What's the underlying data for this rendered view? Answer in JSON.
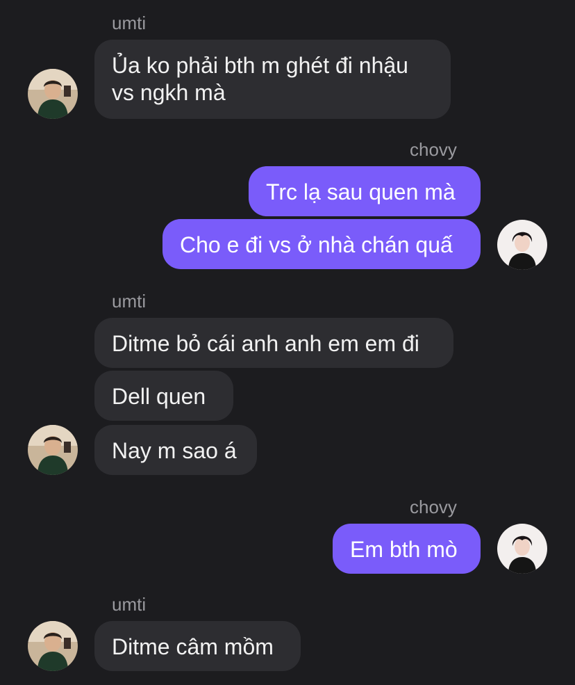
{
  "conversation": {
    "messages": [
      {
        "sender": "umti",
        "text_lines": [
          "Ủa ko phải bth m ghét đi nhậu",
          "vs ngkh mà"
        ],
        "direction": "incoming"
      },
      {
        "sender": "chovy",
        "text": "Trc lạ sau quen mà",
        "direction": "outgoing"
      },
      {
        "text": "Cho e đi vs ở nhà chán quấ",
        "direction": "outgoing"
      },
      {
        "sender": "umti",
        "text": "Ditme bỏ cái anh anh em em đi",
        "direction": "incoming"
      },
      {
        "text": "Dell quen",
        "direction": "incoming"
      },
      {
        "text": "Nay m sao á",
        "direction": "incoming"
      },
      {
        "sender": "chovy",
        "text": "Em bth mò",
        "direction": "outgoing"
      },
      {
        "sender": "umti",
        "text": "Ditme câm mồm",
        "direction": "incoming"
      }
    ]
  },
  "colors": {
    "background": "#1c1c1f",
    "incoming_bubble": "#2d2d31",
    "outgoing_bubble": "#7a5cfa",
    "sender_label": "#9a9a9f"
  }
}
